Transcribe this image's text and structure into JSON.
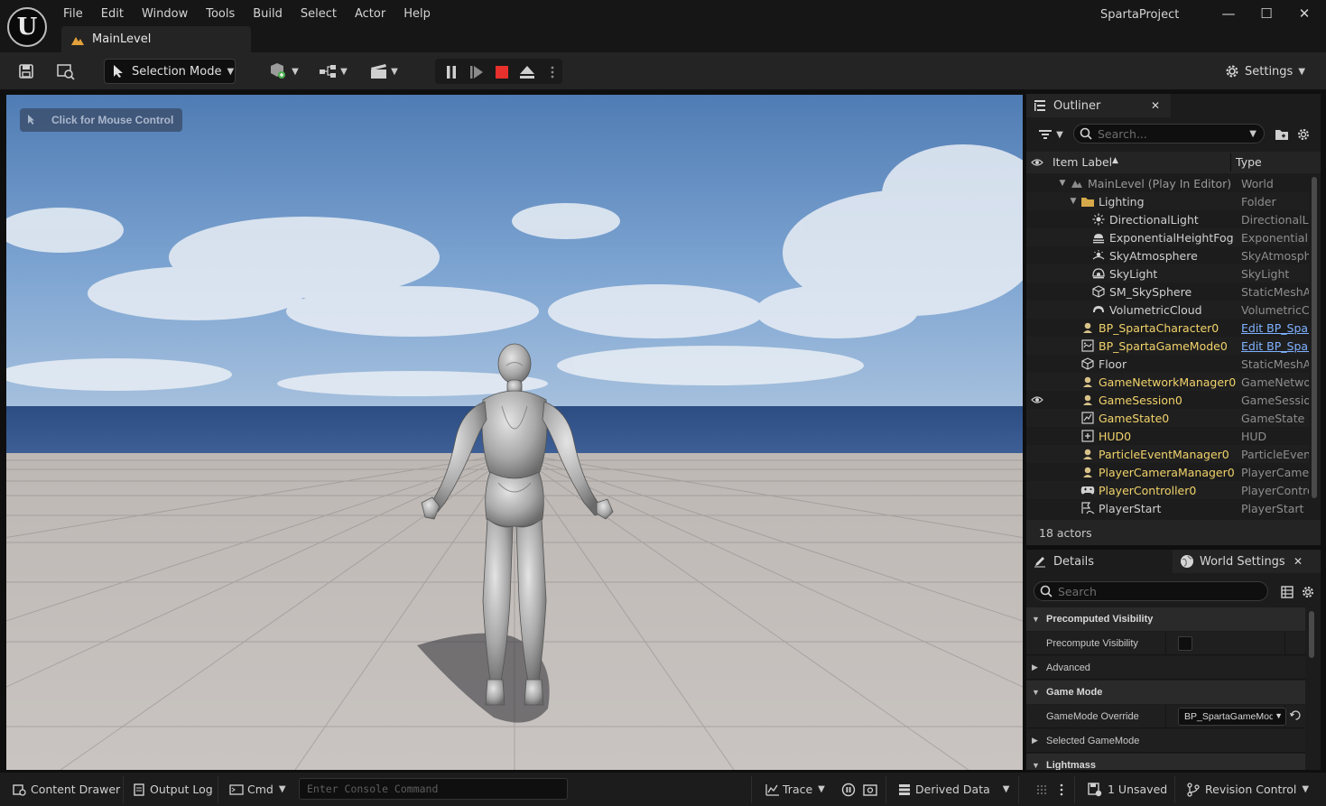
{
  "app": {
    "project_name": "SpartaProject",
    "level_tab": "MainLevel"
  },
  "menu": [
    "File",
    "Edit",
    "Window",
    "Tools",
    "Build",
    "Select",
    "Actor",
    "Help"
  ],
  "window_controls": {
    "minimize": "—",
    "maximize": "☐",
    "close": "✕"
  },
  "toolbar": {
    "selection_mode": "Selection Mode",
    "settings": "Settings",
    "icons": [
      "save-icon",
      "content-browser-icon",
      "add-actor-icon",
      "blueprint-icon",
      "cinematics-icon",
      "pause-icon",
      "step-icon",
      "stop-icon",
      "eject-icon",
      "more-icon"
    ],
    "stop_color": "#e8302c"
  },
  "viewport": {
    "hint": "Click for Mouse Control"
  },
  "outliner": {
    "tab": "Outliner",
    "search_placeholder": "Search...",
    "columns": {
      "label": "Item Label",
      "type": "Type"
    },
    "rows": [
      {
        "label": "MainLevel (Play In Editor)",
        "type": "World",
        "indent": 0,
        "expanded": true,
        "style": "dim",
        "icon": "level-icon",
        "visible": false
      },
      {
        "label": "Lighting",
        "type": "Folder",
        "indent": 1,
        "expanded": true,
        "style": "normal",
        "icon": "folder-icon",
        "visible": false
      },
      {
        "label": "DirectionalLight",
        "type": "DirectionalLight",
        "indent": 2,
        "style": "normal",
        "icon": "sun-icon",
        "visible": false
      },
      {
        "label": "ExponentialHeightFog",
        "type": "ExponentialHeightFog",
        "indent": 2,
        "style": "normal",
        "icon": "fog-icon",
        "visible": false
      },
      {
        "label": "SkyAtmosphere",
        "type": "SkyAtmosphere",
        "indent": 2,
        "style": "normal",
        "icon": "sky-atmosphere-icon",
        "visible": false
      },
      {
        "label": "SkyLight",
        "type": "SkyLight",
        "indent": 2,
        "style": "normal",
        "icon": "skylight-icon",
        "visible": false
      },
      {
        "label": "SM_SkySphere",
        "type": "StaticMeshActor",
        "indent": 2,
        "style": "normal",
        "icon": "static-mesh-icon",
        "visible": false
      },
      {
        "label": "VolumetricCloud",
        "type": "VolumetricCloud",
        "indent": 2,
        "style": "normal",
        "icon": "cloud-icon",
        "visible": false
      },
      {
        "label": "BP_SpartaCharacter0",
        "type": "Edit BP_SpartaCharacter",
        "indent": 1,
        "style": "yellow",
        "type_style": "link",
        "icon": "pawn-icon",
        "visible": false
      },
      {
        "label": "BP_SpartaGameMode0",
        "type": "Edit BP_SpartaGameMode",
        "indent": 1,
        "style": "yellow",
        "type_style": "link",
        "icon": "gamemode-icon",
        "visible": false
      },
      {
        "label": "Floor",
        "type": "StaticMeshActor",
        "indent": 1,
        "style": "normal",
        "icon": "static-mesh-icon",
        "visible": false
      },
      {
        "label": "GameNetworkManager0",
        "type": "GameNetworkManager",
        "indent": 1,
        "style": "yellow",
        "icon": "pawn-icon",
        "visible": false
      },
      {
        "label": "GameSession0",
        "type": "GameSession",
        "indent": 1,
        "style": "yellow",
        "icon": "pawn-icon",
        "visible": true
      },
      {
        "label": "GameState0",
        "type": "GameState",
        "indent": 1,
        "style": "yellow",
        "icon": "gamestate-icon",
        "visible": false
      },
      {
        "label": "HUD0",
        "type": "HUD",
        "indent": 1,
        "style": "yellow",
        "icon": "hud-icon",
        "visible": false
      },
      {
        "label": "ParticleEventManager0",
        "type": "ParticleEventManager",
        "indent": 1,
        "style": "yellow",
        "icon": "pawn-icon",
        "visible": false
      },
      {
        "label": "PlayerCameraManager0",
        "type": "PlayerCameraManager",
        "indent": 1,
        "style": "yellow",
        "icon": "pawn-icon",
        "visible": false
      },
      {
        "label": "PlayerController0",
        "type": "PlayerController",
        "indent": 1,
        "style": "yellow",
        "icon": "controller-icon",
        "visible": false
      },
      {
        "label": "PlayerStart",
        "type": "PlayerStart",
        "indent": 1,
        "style": "normal",
        "icon": "player-start-icon",
        "visible": false
      }
    ],
    "footer": "18 actors"
  },
  "details": {
    "tab": "Details",
    "world_settings_tab": "World Settings",
    "search_placeholder": "Search",
    "rows": [
      {
        "kind": "category",
        "label": "Precomputed Visibility",
        "expanded": true
      },
      {
        "kind": "checkbox",
        "label": "Precompute Visibility",
        "checked": false
      },
      {
        "kind": "subcategory",
        "label": "Advanced",
        "expanded": false
      },
      {
        "kind": "category",
        "label": "Game Mode",
        "expanded": true
      },
      {
        "kind": "dropdown",
        "label": "GameMode Override",
        "value": "BP_SpartaGameMode"
      },
      {
        "kind": "subcategory",
        "label": "Selected GameMode",
        "expanded": false
      },
      {
        "kind": "category",
        "label": "Lightmass",
        "expanded": true
      }
    ]
  },
  "statusbar": {
    "content_drawer": "Content Drawer",
    "output_log": "Output Log",
    "cmd": "Cmd",
    "console_placeholder": "Enter Console Command",
    "trace": "Trace",
    "derived_data": "Derived Data",
    "unsaved": "1 Unsaved",
    "revision_control": "Revision Control"
  }
}
